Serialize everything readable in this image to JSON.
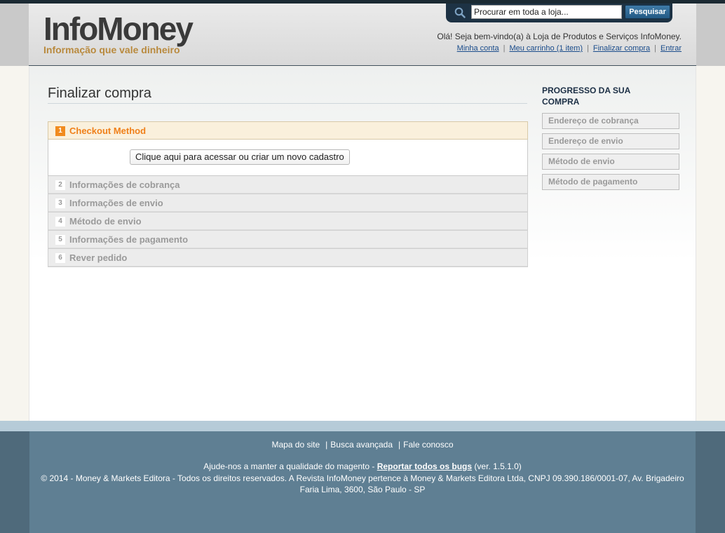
{
  "header": {
    "logo_main": "InfoMoney",
    "logo_tagline": "Informação que vale dinheiro",
    "search_placeholder": "Procurar em toda a loja...",
    "search_button": "Pesquisar",
    "welcome": "Olá! Seja bem-vindo(a) à Loja de Produtos e Serviços InfoMoney.",
    "links": [
      "Minha conta",
      "Meu carrinho (1 item)",
      "Finalizar compra",
      "Entrar"
    ]
  },
  "main": {
    "page_title": "Finalizar compra",
    "steps": [
      {
        "num": "1",
        "label": "Checkout Method",
        "active": true
      },
      {
        "num": "2",
        "label": "Informações de cobrança"
      },
      {
        "num": "3",
        "label": "Informações de envio"
      },
      {
        "num": "4",
        "label": "Método de envio"
      },
      {
        "num": "5",
        "label": "Informações de pagamento"
      },
      {
        "num": "6",
        "label": "Rever pedido"
      }
    ],
    "register_button": "Clique aqui para acessar ou criar um novo cadastro"
  },
  "sidebar": {
    "title": "PROGRESSO DA SUA COMPRA",
    "items": [
      "Endereço de cobrança",
      "Endereço de envio",
      "Método de envio",
      "Método de pagamento"
    ]
  },
  "footer": {
    "links": [
      "Mapa do site",
      "Busca avançada",
      "Fale conosco"
    ],
    "help_prefix": "Ajude-nos a manter a qualidade do magento - ",
    "help_link": "Reportar todos os bugs",
    "help_suffix": " (ver. 1.5.1.0)",
    "copyright": "© 2014 - Money & Markets Editora - Todos os direitos reservados. A Revista InfoMoney pertence à Money & Markets Editora Ltda, CNPJ 09.390.186/0001-07, Av. Brigadeiro Faria Lima, 3600, São Paulo - SP"
  },
  "colors": {
    "accent_orange": "#f0801a",
    "footer_blue": "#5f7f93",
    "header_dark": "#1d3244"
  }
}
